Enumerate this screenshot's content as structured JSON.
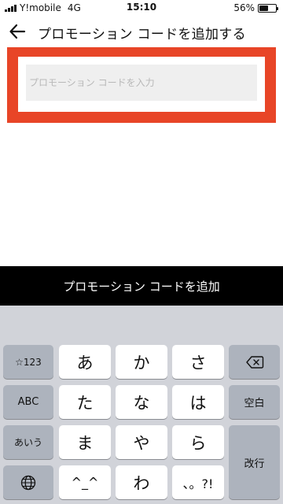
{
  "status": {
    "carrier": "Y!mobile",
    "network": "4G",
    "time": "15:10",
    "battery_percent": "56%",
    "battery_level": 0.56
  },
  "header": {
    "back_icon": "arrow-left-icon",
    "title": "プロモーション コードを追加する"
  },
  "promo": {
    "placeholder": "プロモーション コードを入力",
    "value": "",
    "highlight_color": "#e84527"
  },
  "add_button": {
    "label": "プロモーション コードを追加"
  },
  "keyboard": {
    "row1": {
      "mode": "☆123",
      "keys": [
        "あ",
        "か",
        "さ"
      ],
      "delete_icon": "backspace-icon"
    },
    "row2": {
      "mode": "ABC",
      "keys": [
        "た",
        "な",
        "は"
      ],
      "space": "空白"
    },
    "row3": {
      "mode": "あいう",
      "keys": [
        "ま",
        "や",
        "ら"
      ],
      "return": "改行"
    },
    "row4": {
      "globe_icon": "globe-icon",
      "keys": [
        "^_^",
        "わ",
        "、。?!"
      ]
    }
  }
}
